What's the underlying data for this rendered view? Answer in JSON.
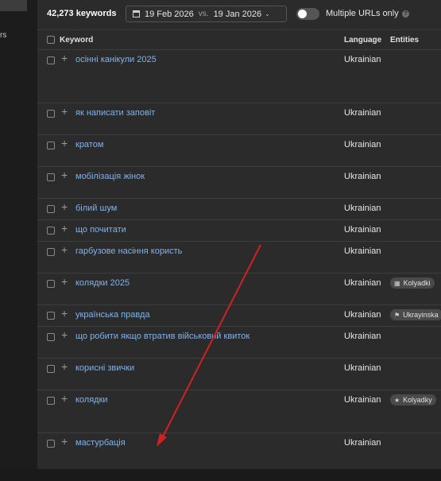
{
  "left_panel": {
    "fragment": "rs"
  },
  "toolbar": {
    "keyword_count": "42,273 keywords",
    "date_from": "19 Feb 2026",
    "vs": "vs.",
    "date_to": "19 Jan 2026",
    "multiple_urls_label": "Multiple URLs only",
    "multiple_urls_enabled": false,
    "help": "?"
  },
  "table": {
    "columns": {
      "keyword": "Keyword",
      "language": "Language",
      "entities": "Entities"
    },
    "rows": [
      {
        "keyword": "осінні канікули 2025",
        "language": "Ukrainian",
        "entity": "",
        "entity_icon": ""
      },
      {
        "keyword": "як написати заповіт",
        "language": "Ukrainian",
        "entity": "",
        "entity_icon": ""
      },
      {
        "keyword": "кратом",
        "language": "Ukrainian",
        "entity": "",
        "entity_icon": ""
      },
      {
        "keyword": "мобілізація жінок",
        "language": "Ukrainian",
        "entity": "",
        "entity_icon": ""
      },
      {
        "keyword": "білий шум",
        "language": "Ukrainian",
        "entity": "",
        "entity_icon": ""
      },
      {
        "keyword": "що почитати",
        "language": "Ukrainian",
        "entity": "",
        "entity_icon": ""
      },
      {
        "keyword": "гарбузове насіння користь",
        "language": "Ukrainian",
        "entity": "",
        "entity_icon": ""
      },
      {
        "keyword": "колядки 2025",
        "language": "Ukrainian",
        "entity": "Kolyadki",
        "entity_icon": "calendar-icon"
      },
      {
        "keyword": "українська правда",
        "language": "Ukrainian",
        "entity": "Ukrayinska",
        "entity_icon": "flag-icon"
      },
      {
        "keyword": "що робити якщо втратив військовий квиток",
        "language": "Ukrainian",
        "entity": "",
        "entity_icon": ""
      },
      {
        "keyword": "корисні звички",
        "language": "Ukrainian",
        "entity": "",
        "entity_icon": ""
      },
      {
        "keyword": "колядки",
        "language": "Ukrainian",
        "entity": "Kolyadky",
        "entity_icon": "star-icon"
      },
      {
        "keyword": "мастурбація",
        "language": "Ukrainian",
        "entity": "",
        "entity_icon": ""
      }
    ]
  },
  "colors": {
    "background": "#242424",
    "panel": "#2b2b2b",
    "keyword_link": "#7fb3ee",
    "annotation_arrow": "#d42020"
  }
}
